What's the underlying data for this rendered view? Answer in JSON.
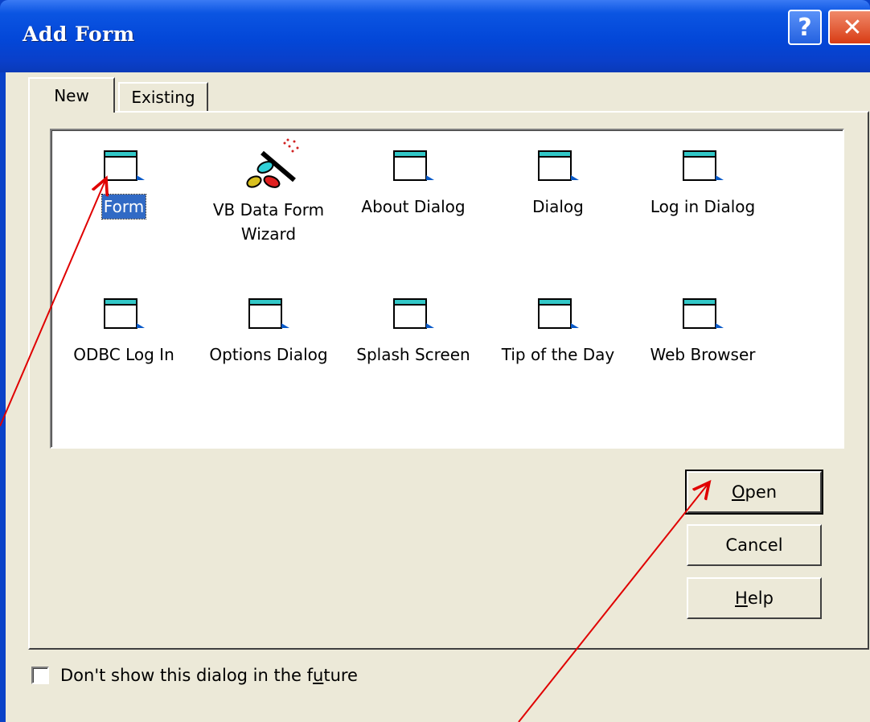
{
  "window": {
    "title": "Add Form",
    "help_button": "?",
    "close_button": "✕"
  },
  "tabs": [
    {
      "label": "New",
      "active": true
    },
    {
      "label": "Existing",
      "active": false
    }
  ],
  "templates": [
    {
      "label": "Form",
      "icon": "form-icon",
      "selected": true
    },
    {
      "label": "VB Data Form Wizard",
      "icon": "magic-wand-icon",
      "selected": false
    },
    {
      "label": "About Dialog",
      "icon": "form-icon",
      "selected": false
    },
    {
      "label": "Dialog",
      "icon": "form-icon",
      "selected": false
    },
    {
      "label": "Log in Dialog",
      "icon": "form-icon",
      "selected": false
    },
    {
      "label": "ODBC Log In",
      "icon": "form-icon",
      "selected": false
    },
    {
      "label": "Options Dialog",
      "icon": "form-icon",
      "selected": false
    },
    {
      "label": "Splash Screen",
      "icon": "form-icon",
      "selected": false
    },
    {
      "label": "Tip of the Day",
      "icon": "form-icon",
      "selected": false
    },
    {
      "label": "Web Browser",
      "icon": "form-icon",
      "selected": false
    }
  ],
  "buttons": {
    "open": {
      "mnemonic": "O",
      "rest": "pen"
    },
    "cancel": "Cancel",
    "help": {
      "mnemonic": "H",
      "rest": "elp"
    }
  },
  "checkbox": {
    "label_before": "Don't show this dialog in the f",
    "label_mnemonic": "u",
    "label_after": "ture",
    "checked": false
  },
  "colors": {
    "titlebar": "#0347d8",
    "face": "#ece9d8",
    "selection": "#316ac5",
    "annotation_arrow": "#e00000"
  }
}
